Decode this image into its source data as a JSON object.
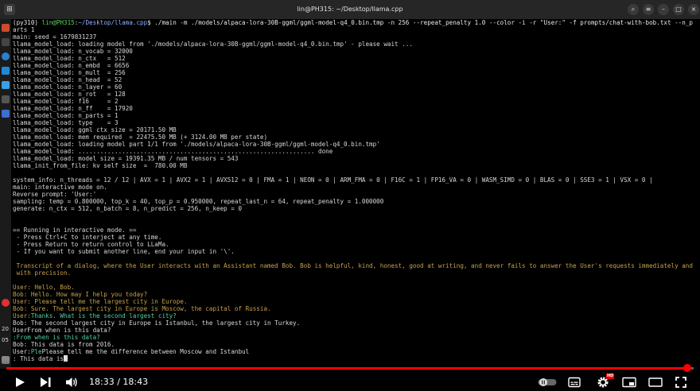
{
  "window": {
    "title": "lin@PH315: ~/Desktop/llama.cpp"
  },
  "dock": {
    "labels": [
      "20",
      "05"
    ]
  },
  "terminal": {
    "lines": [
      {
        "parts": [
          {
            "t": "(py310) ",
            "c": "c-white"
          },
          {
            "t": "lin@PH315",
            "c": "c-green"
          },
          {
            "t": ":",
            "c": "c-white"
          },
          {
            "t": "~/Desktop/llama.cpp",
            "c": "c-blue"
          },
          {
            "t": "$ ./main -m ./models/alpaca-lora-30B-ggml/ggml-model-q4_0.bin.tmp -n 256 --repeat_penalty 1.0 --color -i -r \"User:\" -f prompts/chat-with-bob.txt --n_p",
            "c": "c-white"
          }
        ]
      },
      {
        "parts": [
          {
            "t": "arts 1",
            "c": ""
          }
        ]
      },
      {
        "parts": [
          {
            "t": "main: seed = 1679831237",
            "c": ""
          }
        ]
      },
      {
        "parts": [
          {
            "t": "llama_model_load: loading model from './models/alpaca-lora-30B-ggml/ggml-model-q4_0.bin.tmp' - please wait ...",
            "c": ""
          }
        ]
      },
      {
        "parts": [
          {
            "t": "llama_model_load: n_vocab = 32000",
            "c": ""
          }
        ]
      },
      {
        "parts": [
          {
            "t": "llama_model_load: n_ctx   = 512",
            "c": ""
          }
        ]
      },
      {
        "parts": [
          {
            "t": "llama_model_load: n_embd  = 6656",
            "c": ""
          }
        ]
      },
      {
        "parts": [
          {
            "t": "llama_model_load: n_mult  = 256",
            "c": ""
          }
        ]
      },
      {
        "parts": [
          {
            "t": "llama_model_load: n_head  = 52",
            "c": ""
          }
        ]
      },
      {
        "parts": [
          {
            "t": "llama_model_load: n_layer = 60",
            "c": ""
          }
        ]
      },
      {
        "parts": [
          {
            "t": "llama_model_load: n_rot   = 128",
            "c": ""
          }
        ]
      },
      {
        "parts": [
          {
            "t": "llama_model_load: f16     = 2",
            "c": ""
          }
        ]
      },
      {
        "parts": [
          {
            "t": "llama_model_load: n_ff    = 17920",
            "c": ""
          }
        ]
      },
      {
        "parts": [
          {
            "t": "llama_model_load: n_parts = 1",
            "c": ""
          }
        ]
      },
      {
        "parts": [
          {
            "t": "llama_model_load: type    = 3",
            "c": ""
          }
        ]
      },
      {
        "parts": [
          {
            "t": "llama_model_load: ggml ctx size = 20171.50 MB",
            "c": ""
          }
        ]
      },
      {
        "parts": [
          {
            "t": "llama_model_load: mem required  = 22475.50 MB (+ 3124.00 MB per state)",
            "c": ""
          }
        ]
      },
      {
        "parts": [
          {
            "t": "llama_model_load: loading model part 1/1 from './models/alpaca-lora-30B-ggml/ggml-model-q4_0.bin.tmp'",
            "c": ""
          }
        ]
      },
      {
        "parts": [
          {
            "t": "llama_model_load: ................................................................. done",
            "c": ""
          }
        ]
      },
      {
        "parts": [
          {
            "t": "llama_model_load: model size = 19391.35 MB / num tensors = 543",
            "c": ""
          }
        ]
      },
      {
        "parts": [
          {
            "t": "llama_init_from_file: kv self size  =  780.00 MB",
            "c": ""
          }
        ]
      },
      {
        "parts": [
          {
            "t": "",
            "c": ""
          }
        ]
      },
      {
        "parts": [
          {
            "t": "system_info: n_threads = 12 / 12 | AVX = 1 | AVX2 = 1 | AVX512 = 0 | FMA = 1 | NEON = 0 | ARM_FMA = 0 | F16C = 1 | FP16_VA = 0 | WASM_SIMD = 0 | BLAS = 0 | SSE3 = 1 | VSX = 0 |",
            "c": ""
          }
        ]
      },
      {
        "parts": [
          {
            "t": "main: interactive mode on.",
            "c": ""
          }
        ]
      },
      {
        "parts": [
          {
            "t": "Reverse prompt: 'User:'",
            "c": ""
          }
        ]
      },
      {
        "parts": [
          {
            "t": "sampling: temp = 0.800000, top_k = 40, top_p = 0.950000, repeat_last_n = 64, repeat_penalty = 1.000000",
            "c": ""
          }
        ]
      },
      {
        "parts": [
          {
            "t": "generate: n_ctx = 512, n_batch = 8, n_predict = 256, n_keep = 0",
            "c": ""
          }
        ]
      },
      {
        "parts": [
          {
            "t": "",
            "c": ""
          }
        ]
      },
      {
        "parts": [
          {
            "t": "",
            "c": ""
          }
        ]
      },
      {
        "parts": [
          {
            "t": "== Running in interactive mode. ==",
            "c": ""
          }
        ]
      },
      {
        "parts": [
          {
            "t": " - Press Ctrl+C to interject at any time.",
            "c": ""
          }
        ]
      },
      {
        "parts": [
          {
            "t": " - Press Return to return control to LLaMa.",
            "c": ""
          }
        ]
      },
      {
        "parts": [
          {
            "t": " - If you want to submit another line, end your input in '\\'.",
            "c": ""
          }
        ]
      },
      {
        "parts": [
          {
            "t": "",
            "c": ""
          }
        ]
      },
      {
        "parts": [
          {
            "t": " Transcript of a dialog, where the User interacts with an Assistant named Bob. Bob is helpful, kind, honest, good at writing, and never fails to answer the User's requests immediately and",
            "c": "c-yellow"
          }
        ]
      },
      {
        "parts": [
          {
            "t": " with precision.",
            "c": "c-yellow"
          }
        ]
      },
      {
        "parts": [
          {
            "t": "",
            "c": ""
          }
        ]
      },
      {
        "parts": [
          {
            "t": "User: Hello, Bob.",
            "c": "c-yellow"
          }
        ]
      },
      {
        "parts": [
          {
            "t": "Bob: Hello. How may I help you today?",
            "c": "c-yellow"
          }
        ]
      },
      {
        "parts": [
          {
            "t": "User: Please tell me the largest city in Europe.",
            "c": "c-yellow"
          }
        ]
      },
      {
        "parts": [
          {
            "t": "Bob: Sure. The largest city in Europe is Moscow, the capital of Russia.",
            "c": "c-yellow"
          }
        ]
      },
      {
        "parts": [
          {
            "t": "User:",
            "c": "c-yellow"
          },
          {
            "t": "Thanks. What is the second largest city?",
            "c": "c-teal"
          }
        ]
      },
      {
        "parts": [
          {
            "t": "Bob: The second largest city in Europe is Istanbul, the largest city in Turkey.",
            "c": ""
          }
        ]
      },
      {
        "parts": [
          {
            "t": "UserFrom when is this data?",
            "c": ""
          }
        ]
      },
      {
        "parts": [
          {
            "t": ":From when is this data?",
            "c": "c-teal"
          }
        ]
      },
      {
        "parts": [
          {
            "t": "Bob: This data is from 2016.",
            "c": ""
          }
        ]
      },
      {
        "parts": [
          {
            "t": "User:",
            "c": ""
          },
          {
            "t": "Ple",
            "c": "c-teal"
          },
          {
            "t": "Please tell me the difference between Moscow and Istanbul",
            "c": ""
          }
        ]
      },
      {
        "parts": [
          {
            "t": ": This data is",
            "c": ""
          }
        ]
      }
    ]
  },
  "player": {
    "current_time": "18:33",
    "separator": " / ",
    "duration": "18:43",
    "progress_fraction": 0.991,
    "hd_badge": "HD",
    "accent_color": "#ff0000"
  }
}
